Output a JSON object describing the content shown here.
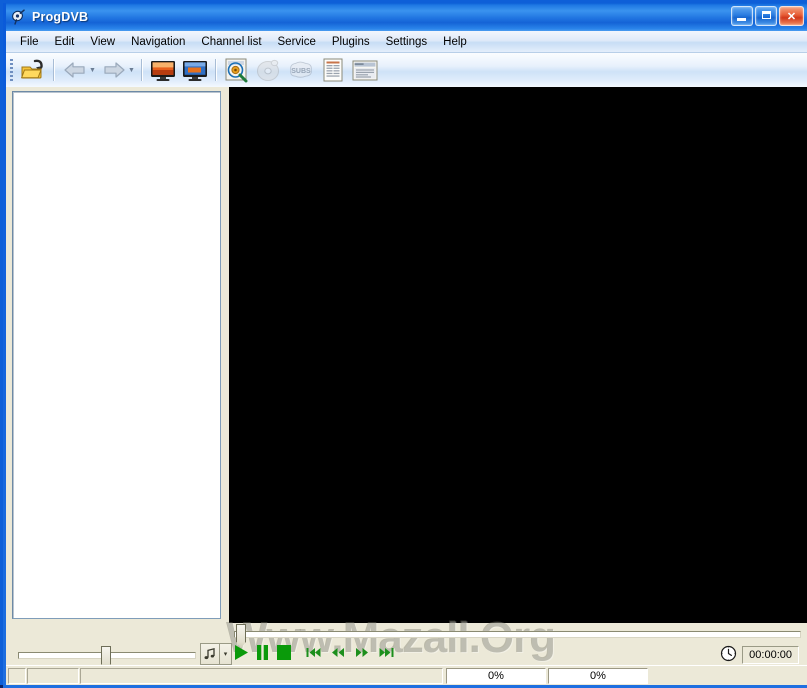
{
  "window": {
    "title": "ProgDVB",
    "icon": "satellite-dish-icon",
    "minimize_label": "Minimize",
    "maximize_label": "Maximize",
    "close_label": "Close",
    "close_glyph": "✕"
  },
  "menubar": {
    "items": [
      {
        "label": "File"
      },
      {
        "label": "Edit"
      },
      {
        "label": "View"
      },
      {
        "label": "Navigation"
      },
      {
        "label": "Channel list"
      },
      {
        "label": "Service"
      },
      {
        "label": "Plugins"
      },
      {
        "label": "Settings"
      },
      {
        "label": "Help"
      }
    ]
  },
  "toolbar": {
    "buttons": [
      {
        "name": "open-folder-button",
        "icon": "open-folder-icon",
        "enabled": true
      },
      {
        "name": "back-button",
        "icon": "back-arrow-icon",
        "enabled": false
      },
      {
        "name": "forward-button",
        "icon": "forward-arrow-icon",
        "enabled": false
      },
      {
        "name": "tv-button",
        "icon": "tv-monitor-icon",
        "enabled": true
      },
      {
        "name": "radio-button",
        "icon": "tv-monitor-blue-icon",
        "enabled": true
      },
      {
        "name": "channel-scan-button",
        "icon": "scan-search-icon",
        "enabled": true
      },
      {
        "name": "record-disc-button",
        "icon": "disc-icon",
        "enabled": false
      },
      {
        "name": "subtitles-button",
        "icon": "subs-icon",
        "enabled": false
      },
      {
        "name": "epg-button",
        "icon": "epg-document-icon",
        "enabled": true
      },
      {
        "name": "teletext-button",
        "icon": "teletext-icon",
        "enabled": true
      }
    ]
  },
  "channel_list": {
    "items": [],
    "empty": ""
  },
  "player": {
    "seek": {
      "value": 0,
      "min": 0,
      "max": 100
    },
    "volume": {
      "value": 50,
      "min": 0,
      "max": 100
    },
    "audio_track_button": "audio-track-icon",
    "audio_track_dropdown": "▾",
    "transport": [
      {
        "name": "play-button",
        "icon": "play-icon",
        "label": "Play"
      },
      {
        "name": "pause-button",
        "icon": "pause-icon",
        "label": "Pause"
      },
      {
        "name": "stop-button",
        "icon": "stop-icon",
        "label": "Stop"
      }
    ],
    "navigation": [
      {
        "name": "skip-previous-button",
        "icon": "skip-previous-icon"
      },
      {
        "name": "rewind-button",
        "icon": "rewind-icon"
      },
      {
        "name": "fast-forward-button",
        "icon": "fast-forward-icon"
      },
      {
        "name": "skip-next-button",
        "icon": "skip-next-icon"
      }
    ],
    "clock_icon": "clock-icon",
    "time": "00:00:00"
  },
  "statusbar": {
    "cells": [
      "",
      "",
      ""
    ],
    "progress_1": "0%",
    "progress_2": "0%"
  },
  "watermark": {
    "text": "Www.Mazall.Org"
  },
  "colors": {
    "title_blue": "#0b5fd6",
    "client_bg": "#ece9d8",
    "video_bg": "#000000",
    "list_bg": "#ffffff",
    "accent_green": "#00a000"
  }
}
